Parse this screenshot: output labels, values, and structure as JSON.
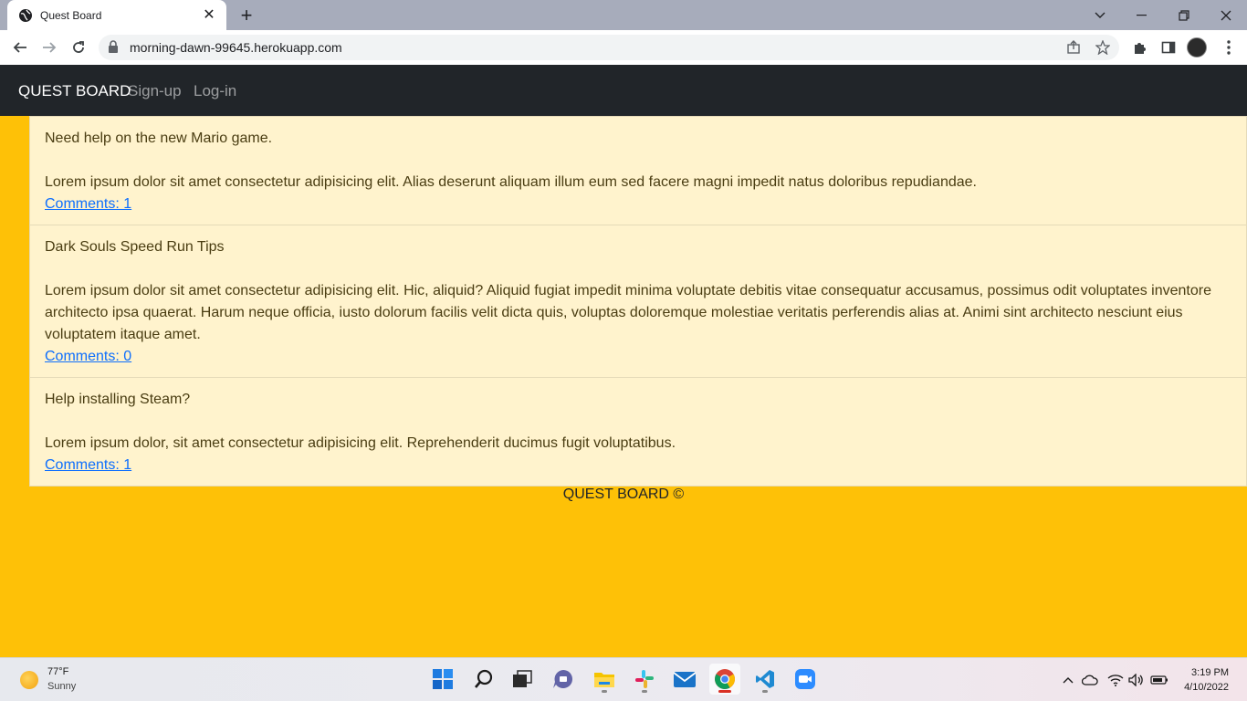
{
  "browser": {
    "tab_title": "Quest Board",
    "url": "morning-dawn-99645.herokuapp.com"
  },
  "navbar": {
    "brand": "QUEST BOARD",
    "links": [
      "Sign-up",
      "Log-in"
    ]
  },
  "quests": [
    {
      "title": "Need help on the new Mario game.",
      "body": "Lorem ipsum dolor sit amet consectetur adipisicing elit. Alias deserunt aliquam illum eum sed facere magni impedit natus doloribus repudiandae.",
      "comments": "Comments: 1"
    },
    {
      "title": "Dark Souls Speed Run Tips",
      "body": "Lorem ipsum dolor sit amet consectetur adipisicing elit. Hic, aliquid? Aliquid fugiat impedit minima voluptate debitis vitae consequatur accusamus, possimus odit voluptates inventore architecto ipsa quaerat. Harum neque officia, iusto dolorum facilis velit dicta quis, voluptas doloremque molestiae veritatis perferendis alias at. Animi sint architecto nesciunt eius voluptatem itaque amet.",
      "comments": "Comments: 0"
    },
    {
      "title": "Help installing Steam?",
      "body": "Lorem ipsum dolor, sit amet consectetur adipisicing elit. Reprehenderit ducimus fugit voluptatibus.",
      "comments": "Comments: 1"
    }
  ],
  "footer": "QUEST BOARD ©",
  "taskbar": {
    "weather_temp": "77°F",
    "weather_cond": "Sunny",
    "time": "3:19 PM",
    "date": "4/10/2022",
    "apps": [
      "windows-start",
      "search",
      "task-view",
      "teams-chat",
      "file-explorer",
      "slack",
      "mail",
      "chrome",
      "vscode",
      "zoom"
    ]
  },
  "colors": {
    "page_bg": "#fec107",
    "card_bg": "#fff3cd",
    "navbar_bg": "#212529",
    "link": "#0d6efd"
  }
}
